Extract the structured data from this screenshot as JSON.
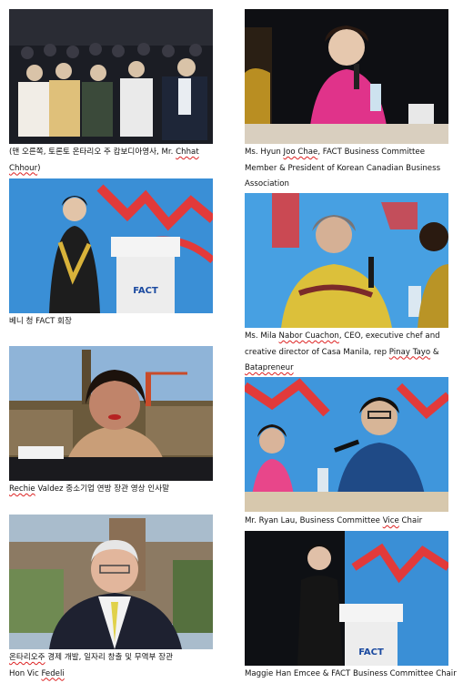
{
  "captions": {
    "c1": {
      "a": "(맨 오른쪽, 토론토 온타리오 주 캄보디아영사, Mr. ",
      "b": "Chhat Chhour",
      "c": ")"
    },
    "c2": {
      "a": "Ms. Hyun ",
      "b": "Joo Chae",
      "c": ", FACT Business Committee Member & President of Korean Canadian Business Association"
    },
    "c3": {
      "a": "베니 청 FACT 회장"
    },
    "c4": {
      "a": "Ms. Mila ",
      "b": "Nabor Cuachon",
      "c": ", CEO, executive chef and creative director of Casa Manila, rep ",
      "d": "Pinay Tayo",
      "e": " & ",
      "f": "Batapreneur"
    },
    "c5": {
      "a": "Rechie",
      "b": " Valdez 중소기업 연방 장관 영상 인사말"
    },
    "c6": {
      "a": "Mr. Ryan Lau, Business Committee ",
      "b": "Vice",
      "c": " Chair"
    },
    "c7": {
      "a": "온타리오주",
      "b": " 경제 개발, 일자리 창출 및 무역부 장관",
      "c": "Hon Vic ",
      "d": "Fedeli"
    },
    "c8": {
      "a": "Maggie Han Emcee & FACT Business Committee Chair"
    }
  },
  "logos": {
    "fact": "FACT"
  },
  "colors": {
    "stage_blue": "#3a8fd6",
    "stage_red": "#e23a3a",
    "dark": "#121418"
  }
}
